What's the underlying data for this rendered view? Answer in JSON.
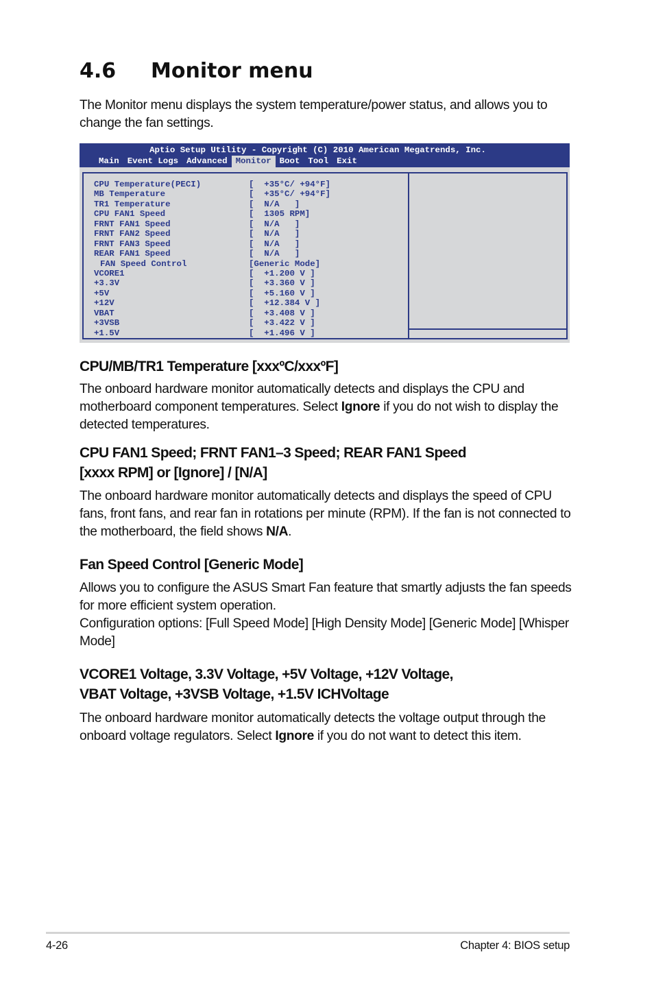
{
  "page": {
    "section_number": "4.6",
    "section_title": "Monitor menu",
    "intro": "The Monitor menu displays the system temperature/power status, and allows you to change the fan settings."
  },
  "bios": {
    "title": "Aptio Setup Utility - Copyright (C) 2010 American Megatrends, Inc.",
    "tabs": [
      {
        "label": "Main",
        "active": false
      },
      {
        "label": "Event Logs",
        "active": false
      },
      {
        "label": "Advanced",
        "active": false
      },
      {
        "label": "Monitor",
        "active": true
      },
      {
        "label": "Boot",
        "active": false
      },
      {
        "label": "Tool",
        "active": false
      },
      {
        "label": "Exit",
        "active": false
      }
    ],
    "rows": [
      {
        "label": "CPU Temperature(PECI)",
        "value": "[  +35°C/ +94°F]"
      },
      {
        "label": "MB Temperature",
        "value": "[  +35°C/ +94°F]"
      },
      {
        "label": "TR1 Temperature",
        "value": "[  N/A   ]"
      },
      {
        "label": "CPU FAN1 Speed",
        "value": "[  1305 RPM]"
      },
      {
        "label": "FRNT FAN1 Speed",
        "value": "[  N/A   ]"
      },
      {
        "label": "FRNT FAN2 Speed",
        "value": "[  N/A   ]"
      },
      {
        "label": "FRNT FAN3 Speed",
        "value": "[  N/A   ]"
      },
      {
        "label": "REAR FAN1 Speed",
        "value": "[  N/A   ]"
      },
      {
        "label": "FAN Speed Control",
        "value": "[Generic Mode]"
      },
      {
        "label": "VCORE1",
        "value": "[  +1.200 V ]"
      },
      {
        "label": "+3.3V",
        "value": "[  +3.360 V ]"
      },
      {
        "label": "+5V",
        "value": "[  +5.160 V ]"
      },
      {
        "label": "+12V",
        "value": "[  +12.384 V ]"
      },
      {
        "label": "VBAT",
        "value": "[  +3.408 V ]"
      },
      {
        "label": "+3VSB",
        "value": "[  +3.422 V ]"
      },
      {
        "label": "+1.5V",
        "value": "[  +1.496 V ]"
      }
    ]
  },
  "sections": {
    "temp": {
      "heading": "CPU/MB/TR1 Temperature [xxxºC/xxxºF]",
      "body_1": "The onboard hardware monitor automatically detects and displays the CPU and motherboard component temperatures. Select ",
      "body_bold": "Ignore",
      "body_2": " if you do not wish to display the detected temperatures."
    },
    "fan": {
      "heading_1": "CPU FAN1 Speed; FRNT FAN1–3 Speed; REAR FAN1 Speed",
      "heading_2": "[xxxx RPM] or [Ignore] / [N/A]",
      "body_1": "The onboard hardware monitor automatically detects and displays the speed of CPU fans, front fans, and rear fan in rotations per minute (RPM). If the fan is not connected to the motherboard, the field shows ",
      "body_bold": "N/A",
      "body_2": "."
    },
    "fan_control": {
      "heading": "Fan Speed Control [Generic Mode]",
      "body_1": "Allows you to configure the ASUS Smart Fan feature that smartly adjusts the fan speeds for more efficient system operation.",
      "body_2": "Configuration options: [Full Speed Mode] [High Density Mode] [Generic Mode] [Whisper Mode]"
    },
    "voltage": {
      "heading_1": "VCORE1 Voltage, 3.3V Voltage, +5V Voltage, +12V Voltage,",
      "heading_2": "VBAT Voltage, +3VSB Voltage, +1.5V ICHVoltage",
      "body_1": "The onboard hardware monitor automatically detects the voltage output through the onboard voltage regulators. Select ",
      "body_bold": "Ignore",
      "body_2": " if you do not want to detect this item."
    }
  },
  "footer": {
    "page_number": "4-26",
    "chapter": "Chapter 4: BIOS setup"
  }
}
